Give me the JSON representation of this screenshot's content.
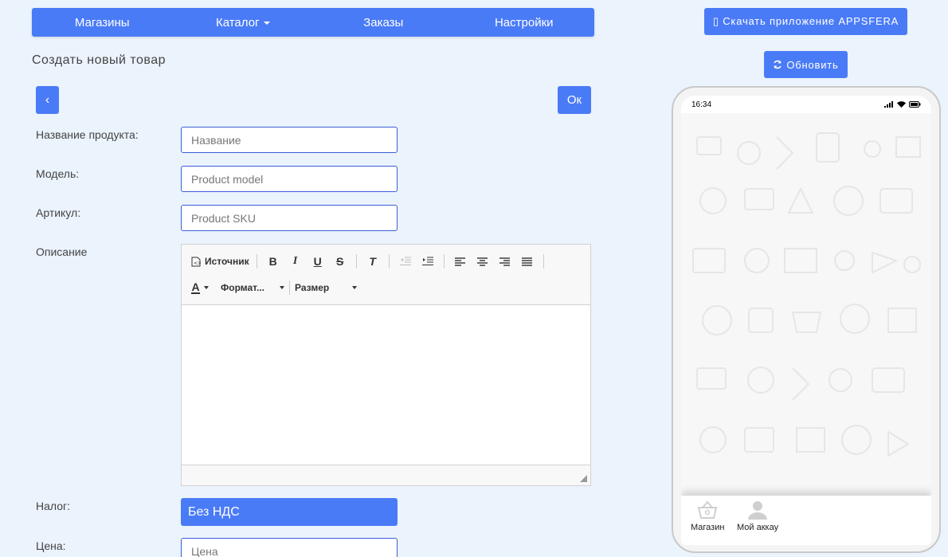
{
  "nav": {
    "items": [
      {
        "label": "Магазины"
      },
      {
        "label": "Каталог"
      },
      {
        "label": "Заказы"
      },
      {
        "label": "Настройки"
      }
    ]
  },
  "page": {
    "title": "Создать новый товар",
    "back_label": "‹",
    "ok_label": "Ок"
  },
  "form": {
    "name_label": "Название продукта:",
    "name_placeholder": "Название",
    "model_label": "Модель:",
    "model_placeholder": "Product model",
    "sku_label": "Артикул:",
    "sku_placeholder": "Product SKU",
    "description_label": "Описание",
    "tax_label": "Налог:",
    "tax_value": "Без НДС",
    "price_label": "Цена:",
    "price_placeholder": "Цена"
  },
  "editor": {
    "source_label": "Источник",
    "bold": "B",
    "italic": "I",
    "underline": "U",
    "strike": "S",
    "remove_format": "T",
    "text_color": "A",
    "format_label": "Формат...",
    "size_label": "Размер"
  },
  "right": {
    "download_label": "▯ Скачать приложение APPSFERA",
    "refresh_label": "Обновить"
  },
  "phone": {
    "time": "16:34",
    "tabs": [
      {
        "label": "Магазин"
      },
      {
        "label": "Мой аккау"
      }
    ]
  },
  "colors": {
    "accent": "#4a7bf7",
    "background": "#ebf3fd"
  }
}
